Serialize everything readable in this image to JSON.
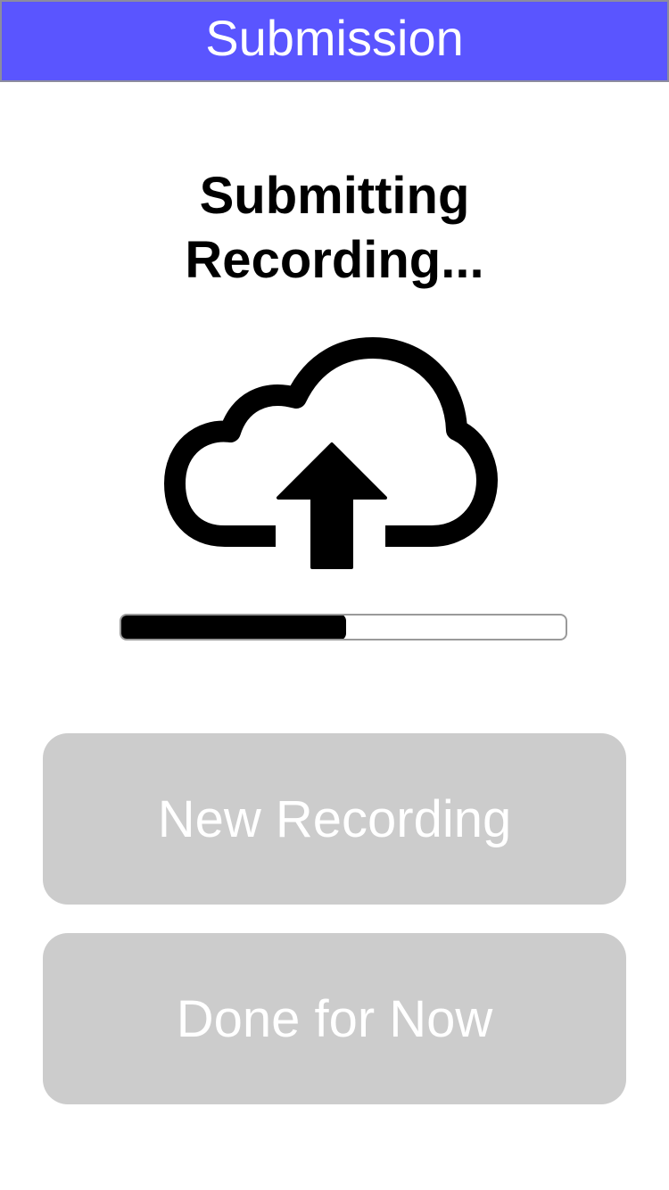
{
  "colors": {
    "header_bg": "#5a55ff",
    "header_text": "#ffffff",
    "progress_fill": "#000000",
    "button_bg_disabled": "#cccccc",
    "button_text_disabled": "#ffffff"
  },
  "header": {
    "title": "Submission"
  },
  "status": {
    "title": "Submitting\nRecording...",
    "icon": "cloud-upload-icon"
  },
  "progress": {
    "fraction": 0.51
  },
  "buttons": {
    "new_recording": "New Recording",
    "done_for_now": "Done for Now"
  }
}
